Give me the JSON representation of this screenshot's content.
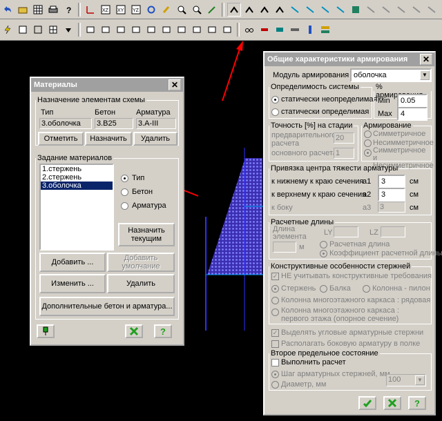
{
  "materials": {
    "title": "Материалы",
    "group1_legend": "Назначение элементам схемы",
    "col_type": "Тип",
    "col_concrete": "Бетон",
    "col_rebar": "Арматура",
    "val_type": "3.оболочка",
    "val_concrete": "3.B25",
    "val_rebar": "3.A-III",
    "btn_cancel": "Отметить",
    "btn_assign": "Назначить",
    "btn_delete": "Удалить",
    "group2_legend": "Задание материалов",
    "list": [
      "1.стержень",
      "2.стержень",
      "3.оболочка"
    ],
    "radio_type": "Тип",
    "radio_concrete": "Бетон",
    "radio_rebar": "Арматура",
    "btn_assign_current": "Назначить текущим",
    "btn_add": "Добавить ...",
    "btn_add_default": "Добавить умолчание",
    "btn_edit": "Изменить ...",
    "btn_delete2": "Удалить",
    "btn_extra": "Дополнительные бетон и арматура..."
  },
  "rebar": {
    "title": "Общие характеристики армирования",
    "module_label": "Модуль армирования",
    "module_value": "оболочка",
    "sys_legend": "Определимость системы",
    "sys_opt1": "статически неопределимая",
    "sys_opt2": "статически определимая",
    "pct_legend": "% армирования",
    "min_label": "Min",
    "min_value": "0.05",
    "max_label": "Max",
    "max_value": "4",
    "acc_legend": "Точность [%] на стадии",
    "acc_pre": "предварительного расчета",
    "acc_pre_value": "20",
    "acc_main": "основного расчета",
    "acc_main_value": "1",
    "arm_legend": "Армирование",
    "arm_opt1": "Симметричное",
    "arm_opt2": "Несимметричное",
    "arm_opt3": "Симметричное и Несимметричное",
    "bind_legend": "Привязка  центра тяжести арматуры",
    "bind_lower": "к нижнему к краю сечения",
    "bind_upper": "к верхнему к краю сечения",
    "bind_side": "к боку",
    "a1": "a1",
    "a2": "a2",
    "a3": "a3",
    "a1_value": "3",
    "a2_value": "3",
    "a3_value": "3",
    "unit_cm": "см",
    "len_legend": "Расчетные длины",
    "len_elem": "Длина элемента",
    "len_ly": "LY",
    "len_lz": "LZ",
    "len_m": "м",
    "len_opt1": "Расчетная длина",
    "len_opt2": "Коэффициент расчетной длины",
    "cons_legend": "Конструктивные особенности стержней",
    "cons_ignore": "НЕ учитывать конструктивные требования",
    "cons_rod": "Стержень",
    "cons_beam": "Балка",
    "cons_column": "Колонна - пилон",
    "cons_multi1": "Колонна многоэтажного каркаса : рядовая",
    "cons_multi2": "Колонна многоэтажного каркаса : первого этажа (опорное сечение)",
    "chk_corner": "Выделять угловые арматурные стержни",
    "chk_side": "Располагать боковую арматуру в полке",
    "second_legend": "Второе предельное состояние",
    "second_check": "Выполнить расчет",
    "second_opt1": "Шаг арматурных стержней, мм",
    "second_opt2": "Диаметр, мм",
    "second_value": "100"
  }
}
